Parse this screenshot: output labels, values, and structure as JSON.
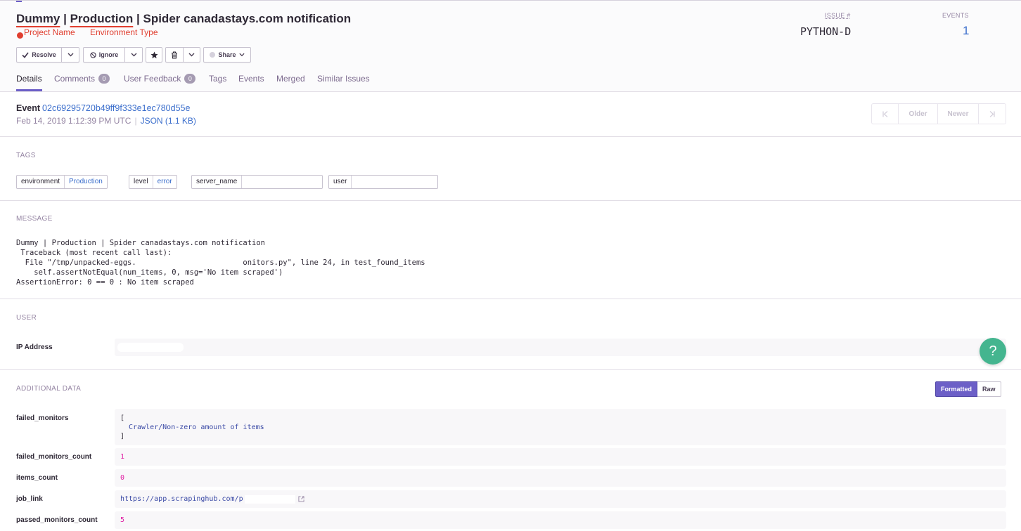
{
  "header": {
    "title_project": "Dummy",
    "title_sep1": " | ",
    "title_env": "Production",
    "title_rest": " | Spider canadastays.com notification",
    "annotation_project": "Project Name",
    "annotation_env": "Environment Type",
    "issue_label": "ISSUE #",
    "issue_value": "PYTHON-D",
    "events_label": "EVENTS",
    "events_value": "1"
  },
  "actions": {
    "resolve": "Resolve",
    "ignore": "Ignore",
    "share": "Share"
  },
  "tabs": [
    {
      "label": "Details"
    },
    {
      "label": "Comments",
      "badge": "0"
    },
    {
      "label": "User Feedback",
      "badge": "0"
    },
    {
      "label": "Tags"
    },
    {
      "label": "Events"
    },
    {
      "label": "Merged"
    },
    {
      "label": "Similar Issues"
    }
  ],
  "event": {
    "label": "Event",
    "id": "02c69295720b49ff9f333e1ec780d55e",
    "date": "Feb 14, 2019 1:12:39 PM UTC",
    "json_link": "JSON (1.1 KB)",
    "pager_older": "Older",
    "pager_newer": "Newer",
    "pager_first": "K",
    "pager_last": "X"
  },
  "tags": {
    "heading": "TAGS",
    "items": [
      {
        "key": "environment",
        "value": "Production"
      },
      {
        "key": "level",
        "value": "error"
      },
      {
        "key": "server_name",
        "value": ""
      },
      {
        "key": "user",
        "value": ""
      }
    ]
  },
  "message": {
    "heading": "MESSAGE",
    "lines": [
      "Dummy | Production | Spider canadastays.com notification",
      " Traceback (most recent call last):",
      "  File \"/tmp/unpacked-eggs.                        onitors.py\", line 24, in test_found_items",
      "    self.assertNotEqual(num_items, 0, msg='No item scraped')",
      "AssertionError: 0 == 0 : No item scraped"
    ]
  },
  "user": {
    "heading": "USER",
    "ip_label": "IP Address",
    "ip_value": ""
  },
  "additional": {
    "heading": "ADDITIONAL DATA",
    "formatted": "Formatted",
    "raw": "Raw",
    "failed_monitors_key": "failed_monitors",
    "failed_monitors_open": "[",
    "failed_monitors_item": "Crawler/Non-zero amount of items",
    "failed_monitors_close": "]",
    "failed_monitors_count_key": "failed_monitors_count",
    "failed_monitors_count_val": "1",
    "items_count_key": "items_count",
    "items_count_val": "0",
    "job_link_key": "job_link",
    "job_link_val": "https://app.scrapinghub.com/p",
    "passed_monitors_count_key": "passed_monitors_count",
    "passed_monitors_count_val": "5"
  },
  "help": "?"
}
